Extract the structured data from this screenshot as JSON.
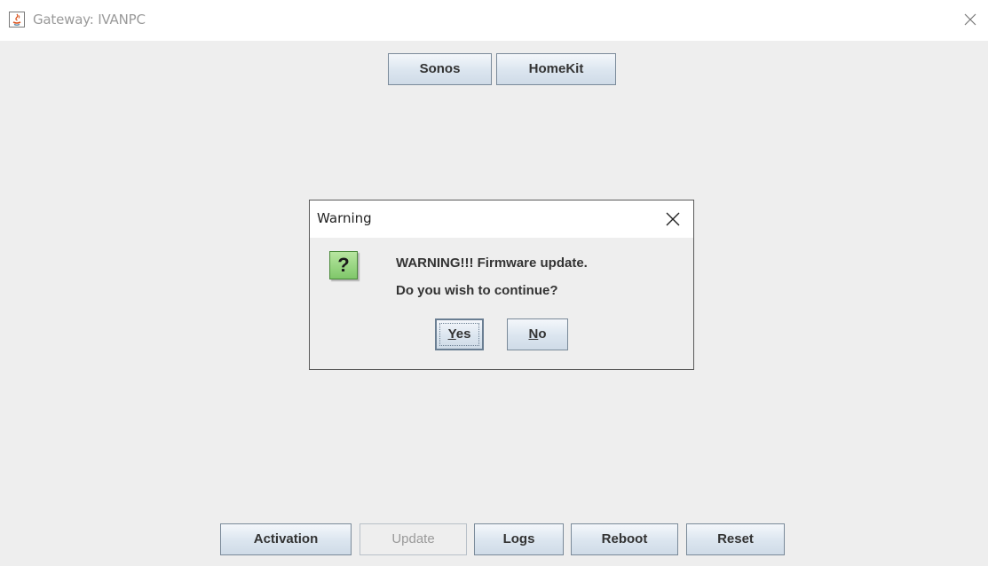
{
  "window": {
    "title": "Gateway: IVANPC",
    "app_icon": "java-icon",
    "close_icon": "close-icon"
  },
  "top_buttons": {
    "sonos": "Sonos",
    "homekit": "HomeKit"
  },
  "dialog": {
    "title": "Warning",
    "icon": "question-icon",
    "icon_glyph": "?",
    "message_line1": "WARNING!!! Firmware update.",
    "message_line2": "Do you wish to continue?",
    "yes_mnemonic": "Y",
    "yes_rest": "es",
    "no_mnemonic": "N",
    "no_rest": "o"
  },
  "bottom_buttons": {
    "activation": "Activation",
    "update": "Update",
    "logs": "Logs",
    "reboot": "Reboot",
    "reset": "Reset"
  },
  "colors": {
    "dialog_icon_green": "#7fc76a",
    "button_gradient_top": "#f4f7fb",
    "button_gradient_bottom": "#cfdbe7"
  }
}
